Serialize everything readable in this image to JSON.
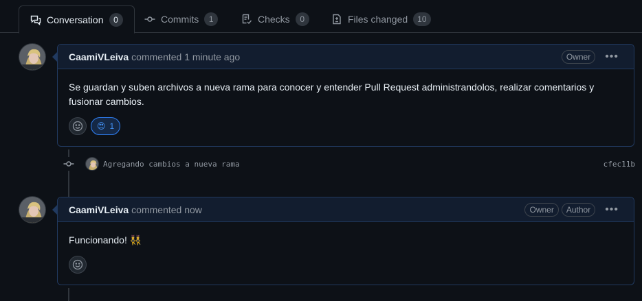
{
  "tabs": [
    {
      "label": "Conversation",
      "count": "0",
      "icon": "comment-discussion-icon"
    },
    {
      "label": "Commits",
      "count": "1",
      "icon": "git-commit-icon"
    },
    {
      "label": "Checks",
      "count": "0",
      "icon": "checklist-icon"
    },
    {
      "label": "Files changed",
      "count": "10",
      "icon": "file-diff-icon"
    }
  ],
  "comments": [
    {
      "author": "CaamiVLeiva",
      "meta": "commented 1 minute ago",
      "labels": [
        "Owner"
      ],
      "body": "Se guardan y suben archivos a nueva rama para conocer y entender Pull Request administrandolos, realizar comentarios y fusionar cambios.",
      "reaction": {
        "emoji": "😍",
        "count": "1"
      }
    },
    {
      "author": "CaamiVLeiva",
      "meta": "commented now",
      "labels": [
        "Owner",
        "Author"
      ],
      "body": "Funcionando! 👯"
    }
  ],
  "commit": {
    "message": "Agregando cambios a nueva rama",
    "sha": "cfec11b"
  },
  "colors": {
    "background": "#0d1117",
    "header_bg": "#121d2f",
    "accent": "#2f81f7",
    "border": "#30363d"
  }
}
